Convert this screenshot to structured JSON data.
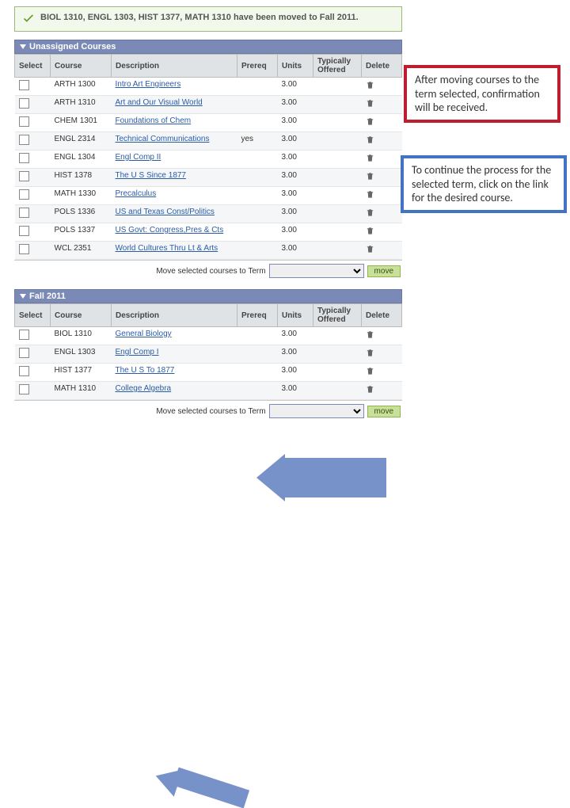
{
  "confirm": {
    "text": "BIOL 1310, ENGL 1303, HIST 1377, MATH 1310 have been moved to Fall 2011."
  },
  "section1": {
    "title": "Unassigned Courses",
    "headers": {
      "select": "Select",
      "course": "Course",
      "desc": "Description",
      "prereq": "Prereq",
      "units": "Units",
      "offered": "Typically Offered",
      "delete": "Delete"
    },
    "rows": [
      {
        "course": "ARTH 1300",
        "desc": "Intro Art Engineers",
        "prereq": "",
        "units": "3.00"
      },
      {
        "course": "ARTH 1310",
        "desc": "Art and Our Visual World",
        "prereq": "",
        "units": "3.00"
      },
      {
        "course": "CHEM 1301",
        "desc": "Foundations of Chem",
        "prereq": "",
        "units": "3.00"
      },
      {
        "course": "ENGL 2314",
        "desc": "Technical Communications",
        "prereq": "yes",
        "units": "3.00"
      },
      {
        "course": "ENGL 1304",
        "desc": "Engl Comp II",
        "prereq": "",
        "units": "3.00"
      },
      {
        "course": "HIST 1378",
        "desc": "The U S Since 1877",
        "prereq": "",
        "units": "3.00"
      },
      {
        "course": "MATH 1330",
        "desc": "Precalculus",
        "prereq": "",
        "units": "3.00"
      },
      {
        "course": "POLS 1336",
        "desc": "US and Texas Const/Politics",
        "prereq": "",
        "units": "3.00"
      },
      {
        "course": "POLS 1337",
        "desc": "US Govt: Congress,Pres & Cts",
        "prereq": "",
        "units": "3.00"
      },
      {
        "course": "WCL 2351",
        "desc": "World Cultures Thru Lt & Arts",
        "prereq": "",
        "units": "3.00"
      }
    ],
    "moveLabel": "Move selected courses to Term",
    "moveBtn": "move"
  },
  "section2": {
    "title": "Fall 2011",
    "headers": {
      "select": "Select",
      "course": "Course",
      "desc": "Description",
      "prereq": "Prereq",
      "units": "Units",
      "offered": "Typically Offered",
      "delete": "Delete"
    },
    "rows": [
      {
        "course": "BIOL 1310",
        "desc": "General Biology",
        "prereq": "",
        "units": "3.00"
      },
      {
        "course": "ENGL 1303",
        "desc": "Engl Comp I",
        "prereq": "",
        "units": "3.00"
      },
      {
        "course": "HIST 1377",
        "desc": "The U S To 1877",
        "prereq": "",
        "units": "3.00"
      },
      {
        "course": "MATH 1310",
        "desc": "College Algebra",
        "prereq": "",
        "units": "3.00"
      }
    ],
    "moveLabel": "Move selected courses to Term",
    "moveBtn": "move"
  },
  "callouts": {
    "red": "After moving courses to the term selected, confirmation will be received.",
    "blue": "To continue the process for the selected term, click on the link for the desired course."
  }
}
